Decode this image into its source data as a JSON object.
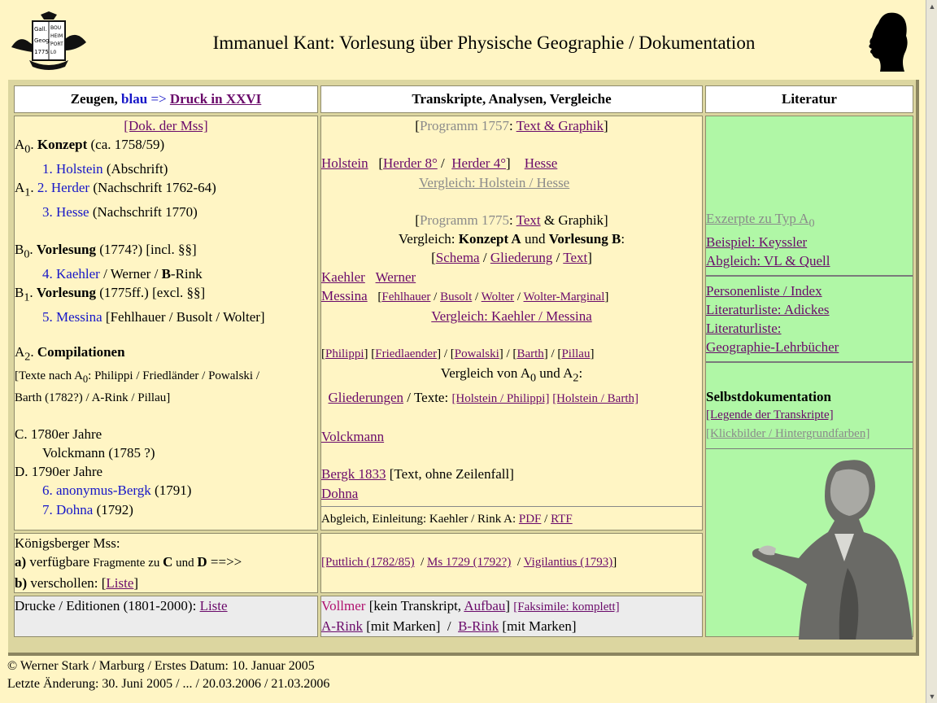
{
  "header": {
    "title": "Immanuel Kant: Vorlesung über Physische Geographie / Dokumentation",
    "logo_text": [
      "Gall.",
      "Geog.",
      "1775",
      "BOU",
      "HEIM",
      "PORT",
      "L0"
    ]
  },
  "columns": {
    "zeugen": {
      "label": "Zeugen,",
      "blau": "blau",
      "arrow": "=>",
      "link": "Druck in XXVI"
    },
    "transkripte": "Transkripte, Analysen, Vergleiche",
    "literatur": "Literatur"
  },
  "zeugen": {
    "dok_link": "[Dok. der Mss]",
    "a0": {
      "pre": "A",
      "sub": "0",
      "dot": ". ",
      "bold": "Konzept",
      "rest": " (ca. 1758/59)"
    },
    "a0_1": {
      "link": "1. Holstein",
      "rest": " (Abschrift)"
    },
    "a1": {
      "pre": "A",
      "sub": "1",
      "dot": ". "
    },
    "a1_2": {
      "link": "2. Herder",
      "rest": " (Nachschrift 1762-64)"
    },
    "a1_3": {
      "link": "3. Hesse",
      "rest": " (Nachschrift 1770)"
    },
    "b0": {
      "pre": "B",
      "sub": "0",
      "dot": ". ",
      "bold": "Vorlesung",
      "rest": " (1774?) [incl. §§]"
    },
    "b0_4": {
      "link": "4. Kaehler",
      "mid": " / Werner / ",
      "bold": "B",
      "rest": "-Rink"
    },
    "b1": {
      "pre": "B",
      "sub": "1",
      "dot": ". ",
      "bold": "Vorlesung",
      "rest": " (1775ff.) [excl. §§]"
    },
    "b1_5": {
      "link": "5. Messina",
      "rest": " [Fehlhauer / Busolt / Wolter]"
    },
    "a2": {
      "pre": "A",
      "sub": "2",
      "dot": ". ",
      "bold": "Compilationen"
    },
    "a2_text1_pre": "[Texte nach A",
    "a2_text1_sub": "0",
    "a2_text1_post": ":  Philippi / Friedländer / Powalski /",
    "a2_text2": "Barth (1782?) / A-Rink / Pillau]",
    "c": "C. 1780er Jahre",
    "c_volck": "Volckmann (1785 ?)",
    "d": "D. 1790er Jahre",
    "d_6": {
      "link": "6. anonymus-Bergk",
      "rest": " (1791)"
    },
    "d_7": {
      "link": "7. Dohna",
      "rest": " (1792)"
    },
    "koenigsberg_title": "Königsberger Mss:",
    "koenigsberg_a": {
      "key": "a)",
      "t1": " verfügbare ",
      "t2": "Fragmente zu ",
      "c": "C",
      "und": " und ",
      "d": "D",
      "arrow": " ==>>"
    },
    "koenigsberg_b": {
      "key": "b)",
      "t1": " verschollen: [",
      "link": "Liste",
      "t2": "]"
    },
    "drucke": {
      "text": "Drucke / Editionen (1801-2000): ",
      "link": "Liste"
    }
  },
  "transkripte": {
    "prog1757": {
      "open": "[",
      "grey": "Programm 1757",
      "colon": ": ",
      "link": "Text & Graphik",
      "close": "]"
    },
    "holstein": "Holstein",
    "herder8": "Herder 8°",
    "herder4": "Herder 4°",
    "hesse": "Hesse",
    "vergleich1": "Vergleich: Holstein / Hesse",
    "prog1775": {
      "open": "[",
      "grey": "Programm 1775",
      "colon": ": ",
      "link": "Text",
      "rest": " & Graphik]"
    },
    "vergleich2": {
      "t1": "Vergleich: ",
      "b1": "Konzept A",
      "t2": " und ",
      "b2": "Vorlesung B",
      "t3": ":"
    },
    "schema_row": {
      "schema": "Schema",
      "gliederung": "Gliederung",
      "text": "Text"
    },
    "kaehler": "Kaehler",
    "werner": "Werner",
    "messina": "Messina",
    "messina_sub": {
      "fehlhauer": "Fehlhauer",
      "busolt": "Busolt",
      "wolter": "Wolter",
      "wolter_marg": "Wolter-Marginal"
    },
    "vergleich3": "Vergleich: Kaehler / Messina",
    "a2_links": {
      "philippi": "Philippi",
      "friedlaender": "Friedlaender",
      "powalski": "Powalski",
      "barth": "Barth",
      "pillau": "Pillau"
    },
    "vergleich4": {
      "pre": "Vergleich von A",
      "sub1": "0",
      "mid": " und A",
      "sub2": "2",
      "post": ":"
    },
    "gliederungen": "Gliederungen",
    "texte": " / Texte: ",
    "holstein_philippi": "[Holstein / Philippi]",
    "holstein_barth": "[Holstein / Barth]",
    "volckmann": "Volckmann",
    "bergk": "Bergk 1833",
    "bergk_rest": " [Text, ohne Zeilenfall]",
    "dohna": "Dohna",
    "abgleich": {
      "text": "Abgleich, Einleitung: Kaehler / Rink A: ",
      "pdf": "PDF",
      "rtf": "RTF"
    },
    "koenigsberg": {
      "puttlich": "[Puttlich (1782/85)",
      "ms1729": "Ms 1729 (1792?)",
      "vigilantius": "Vigilantius (1793)"
    },
    "vollmer": {
      "name": "Vollmer",
      "t1": " [kein Transkript, ",
      "aufbau": "Aufbau",
      "t2": "] ",
      "faksimile": "[Faksimile: komplett]"
    },
    "arink": {
      "link": "A-Rink",
      "rest": " [mit Marken]"
    },
    "brink": {
      "link": "B-Rink",
      "rest": " [mit Marken]"
    }
  },
  "literatur": {
    "exzerpte_pre": "Exzerpte zu Typ A",
    "exzerpte_sub": "0",
    "beispiel": "Beispiel: Keyssler",
    "abgleich": "Abgleich: VL & Quell",
    "personen": "Personenliste / Index",
    "adickes": "Literaturliste: Adickes",
    "lit1": "Literaturliste:",
    "lit2": "Geographie-Lehrbücher",
    "selbst": "Selbstdokumentation",
    "legende": "[Legende der Transkripte]",
    "klickbilder": "[Klickbilder / Hintergrundfarben]"
  },
  "footer": {
    "line1": "© Werner Stark / Marburg / Erstes Datum: 10. Januar 2005",
    "line2": "Letzte Änderung: 30. Juni 2005 / ... / 20.03.2006 / 21.03.2006"
  },
  "colors": {
    "background": "#fff5c4",
    "literatur_bg": "#b0f7a6",
    "link": "#6a0a6a",
    "blue": "#1616c8",
    "grey_row": "#ececec"
  }
}
